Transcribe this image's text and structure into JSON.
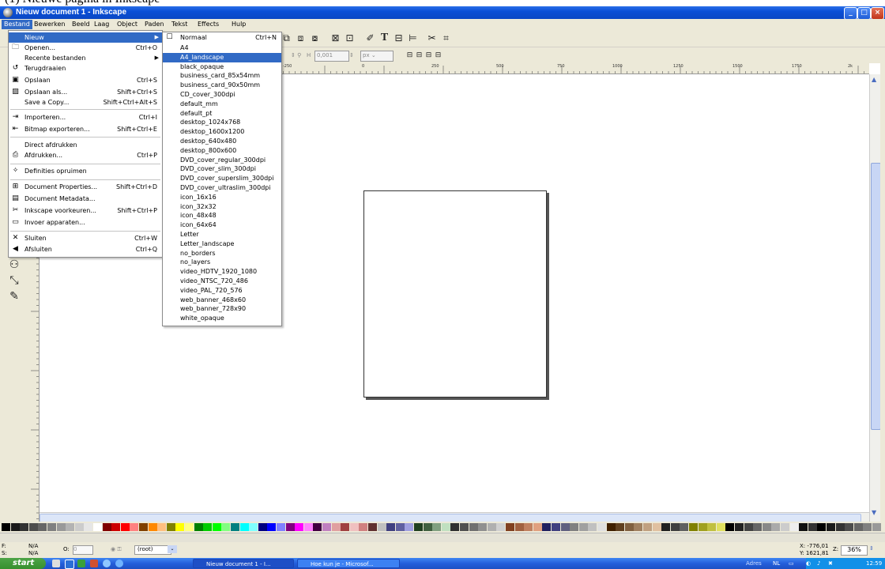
{
  "caption_partial": "(1) Nieuwe pagina in Inkscape",
  "window": {
    "title": "Nieuw document 1 - Inkscape",
    "controls": [
      "_",
      "□",
      "×"
    ]
  },
  "menubar": [
    "Bestand",
    "Bewerken",
    "Beeld",
    "Laag",
    "Object",
    "Paden",
    "Tekst",
    "Effects",
    "Hulp"
  ],
  "controlbar": {
    "h_label": "H",
    "h_value": "0,001",
    "unit": "px"
  },
  "file_menu": [
    {
      "label": "Nieuw",
      "shortcut": "",
      "icon": "blank-icon",
      "submenu": true,
      "highlight": true
    },
    {
      "label": "Openen...",
      "shortcut": "Ctrl+O",
      "icon": "folder-icon"
    },
    {
      "label": "Recente bestanden",
      "shortcut": "",
      "icon": "blank-icon",
      "submenu": true
    },
    {
      "label": "Terugdraaien",
      "shortcut": "",
      "icon": "revert-icon"
    },
    {
      "label": "Opslaan",
      "shortcut": "Ctrl+S",
      "icon": "save-icon"
    },
    {
      "label": "Opslaan als...",
      "shortcut": "Shift+Ctrl+S",
      "icon": "save-as-icon"
    },
    {
      "label": "Save a Copy...",
      "shortcut": "Shift+Ctrl+Alt+S",
      "icon": "blank-icon"
    },
    {
      "label": "Importeren...",
      "shortcut": "Ctrl+I",
      "icon": "import-icon"
    },
    {
      "label": "Bitmap exporteren...",
      "shortcut": "Shift+Ctrl+E",
      "icon": "export-icon"
    },
    {
      "label": "Direct afdrukken",
      "shortcut": "",
      "icon": "blank-icon"
    },
    {
      "label": "Afdrukken...",
      "shortcut": "Ctrl+P",
      "icon": "printer-icon"
    },
    {
      "label": "Definities opruimen",
      "shortcut": "",
      "icon": "clean-icon"
    },
    {
      "label": "Document Properties...",
      "shortcut": "Shift+Ctrl+D",
      "icon": "properties-icon"
    },
    {
      "label": "Document Metadata...",
      "shortcut": "",
      "icon": "metadata-icon"
    },
    {
      "label": "Inkscape voorkeuren...",
      "shortcut": "Shift+Ctrl+P",
      "icon": "preferences-icon"
    },
    {
      "label": "Invoer apparaten...",
      "shortcut": "",
      "icon": "input-devices-icon"
    },
    {
      "label": "Sluiten",
      "shortcut": "Ctrl+W",
      "icon": "close-icon"
    },
    {
      "label": "Afsluiten",
      "shortcut": "Ctrl+Q",
      "icon": "quit-icon"
    }
  ],
  "new_submenu": {
    "first": {
      "label": "Normaal",
      "shortcut": "Ctrl+N"
    },
    "templates": [
      "A4",
      "A4_landscape",
      "black_opaque",
      "business_card_85x54mm",
      "business_card_90x50mm",
      "CD_cover_300dpi",
      "default_mm",
      "default_pt",
      "desktop_1024x768",
      "desktop_1600x1200",
      "desktop_640x480",
      "desktop_800x600",
      "DVD_cover_regular_300dpi",
      "DVD_cover_slim_300dpi",
      "DVD_cover_superslim_300dpi",
      "DVD_cover_ultraslim_300dpi",
      "icon_16x16",
      "icon_32x32",
      "icon_48x48",
      "icon_64x64",
      "Letter",
      "Letter_landscape",
      "no_borders",
      "no_layers",
      "video_HDTV_1920_1080",
      "video_NTSC_720_486",
      "video_PAL_720_576",
      "web_banner_468x60",
      "web_banner_728x90",
      "white_opaque"
    ],
    "highlighted": "A4_landscape"
  },
  "ruler_h": [
    "-250",
    "0",
    "250",
    "500",
    "750",
    "1000",
    "1250",
    "1500",
    "1750",
    "2k"
  ],
  "statusbar": {
    "fill_label": "F:",
    "stroke_label": "S:",
    "fill_value": "N/A",
    "stroke_value": "N/A",
    "opacity_label": "O:",
    "opacity_value": "0",
    "layer": "(root)",
    "x_coord": "X: -776,01",
    "y_coord": "Y: 1621,81",
    "zoom_label": "Z:",
    "zoom": "36%"
  },
  "taskbar": {
    "start": "start",
    "tasks": [
      "Nieuw document 1 - I...",
      "Hoe kun je - Microsof..."
    ],
    "tray_address": "Adres",
    "tray_lang": "NL",
    "clock": "12:59"
  },
  "colors": {
    "menu_highlight": "#316ac5",
    "titlebar": "#0a4fd6",
    "chrome": "#ece9d8"
  }
}
